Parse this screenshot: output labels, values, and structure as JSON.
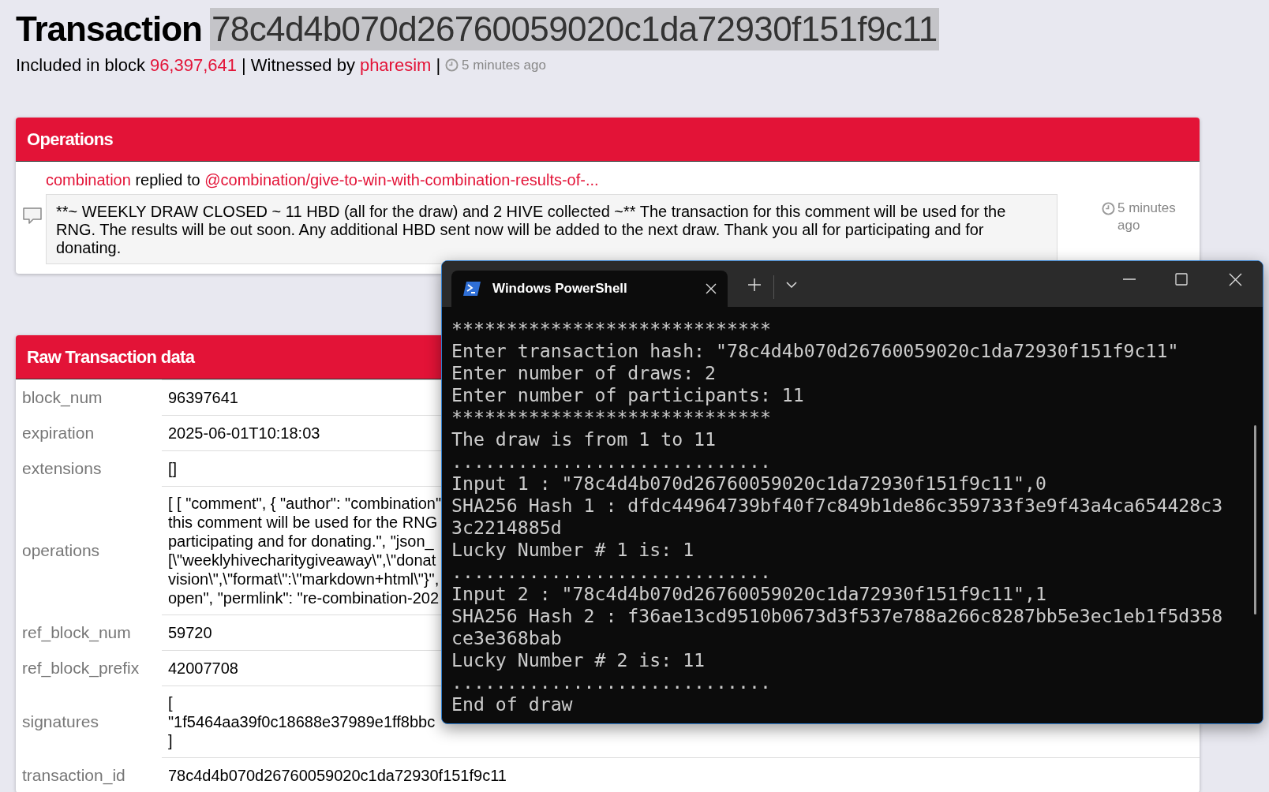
{
  "page": {
    "title": "Transaction",
    "hash": "78c4d4b070d26760059020c1da72930f151f9c11",
    "subtitle": {
      "prefix": "Included in block",
      "block": "96,397,641",
      "witness_label": "| Witnessed by",
      "witness": "pharesim",
      "separator": "|",
      "time": "5 minutes ago"
    }
  },
  "operations": {
    "title": "Operations",
    "items": [
      {
        "author": "combination",
        "action": "replied to",
        "target": "@combination/give-to-win-with-combination-results-of-...",
        "body": "**~ WEEKLY DRAW CLOSED ~ 11 HBD (all for the draw) and 2 HIVE collected ~** The transaction for this comment will be used for the RNG. The results will be out soon. Any additional HBD sent now will be added to the next draw. Thank you all for participating and for donating.",
        "time": "5 minutes ago"
      }
    ]
  },
  "raw_transaction": {
    "title": "Raw Transaction data",
    "rows": [
      {
        "key": "block_num",
        "lines": [
          "96397641"
        ]
      },
      {
        "key": "expiration",
        "lines": [
          "2025-06-01T10:18:03"
        ]
      },
      {
        "key": "extensions",
        "lines": [
          "[]"
        ]
      },
      {
        "key": "operations",
        "lines": [
          "[ [ \"comment\", { \"author\": \"combination\"",
          "this comment will be used for the RNG",
          "participating and for donating.\", \"json_",
          "[\\\"weeklyhivecharitygiveaway\\\",\\\"donat",
          "vision\\\",\\\"format\\\":\\\"markdown+html\\\"}\",",
          "open\", \"permlink\": \"re-combination-202"
        ]
      },
      {
        "key": "ref_block_num",
        "lines": [
          "59720"
        ]
      },
      {
        "key": "ref_block_prefix",
        "lines": [
          "42007708"
        ]
      },
      {
        "key": "signatures",
        "lines": [
          "[",
          "\"1f5464aa39f0c18688e37989e1ff8bbc",
          "]"
        ]
      },
      {
        "key": "transaction_id",
        "lines": [
          "78c4d4b070d26760059020c1da72930f151f9c11"
        ]
      }
    ]
  },
  "terminal": {
    "tab_title": "Windows PowerShell",
    "lines": [
      "*****************************",
      "Enter transaction hash: \"78c4d4b070d26760059020c1da72930f151f9c11\"",
      "Enter number of draws: 2",
      "Enter number of participants: 11",
      "*****************************",
      "The draw is from 1 to 11",
      ".............................",
      "Input 1 : \"78c4d4b070d26760059020c1da72930f151f9c11\",0",
      "SHA256 Hash 1 : dfdc44964739bf40f7c849b1de86c359733f3e9f43a4ca654428c3",
      "3c2214885d",
      "Lucky Number # 1 is: 1",
      ".............................",
      "Input 2 : \"78c4d4b070d26760059020c1da72930f151f9c11\",1",
      "SHA256 Hash 2 : f36ae13cd9510b0673d3f537e788a266c8287bb5e3ec1eb1f5d358",
      "ce3e368bab",
      "Lucky Number # 2 is: 11",
      ".............................",
      "End of draw"
    ]
  }
}
